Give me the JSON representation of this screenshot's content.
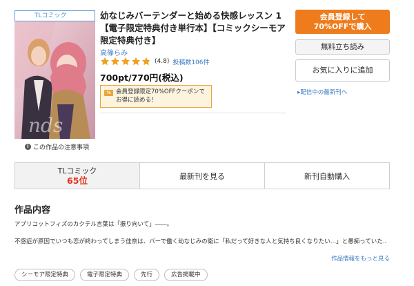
{
  "product": {
    "genre_badge": "TLコミック",
    "title_line1": "幼なじみバーテンダーと始める快感レッスン 1",
    "title_line2": "【電子限定特典付き単行本】【コミックシーモア",
    "title_line3": "限定特典付き】",
    "author": "高篠らみ",
    "rating_value": "(4.8)",
    "rating_score": 4.8,
    "review_count": "投稿数106件",
    "price": "700pt/770円(税込)",
    "coupon_line1": "会員登録限定70%OFFクーポンで",
    "coupon_line2": "お得に読める！",
    "caution_link": "この作品の注意事項"
  },
  "actions": {
    "register_line1": "会員登録して",
    "register_line2": "70%OFFで購入",
    "sample": "無料立ち読み",
    "favorite": "お気に入りに追加",
    "latest": "▸配信中の最新刊へ"
  },
  "tabs": {
    "rank_genre": "TLコミック",
    "rank_position": "65位",
    "latest_volume": "最新刊を見る",
    "auto_purchase": "新刊自動購入"
  },
  "description": {
    "heading": "作品内容",
    "line1": "アプリコットフィズのカクテル言葉は「振り向いて」――。",
    "line2": "不感症が原因でいつも恋が終わってしまう佳奈は、バーで働く幼なじみの衛に「私だって好きな人と気持ち良くなりたい…」と愚痴ってい",
    "line2_suffix": "た…",
    "more": "作品情報をもっと見る"
  },
  "tags": [
    "シーモア限定特典",
    "電子限定特典",
    "先行",
    "広告掲載中"
  ],
  "colors": {
    "accent_orange": "#ee7c1d",
    "link_blue": "#3b7ac4",
    "star_orange": "#f0a020",
    "rank_red": "#e5321c"
  }
}
